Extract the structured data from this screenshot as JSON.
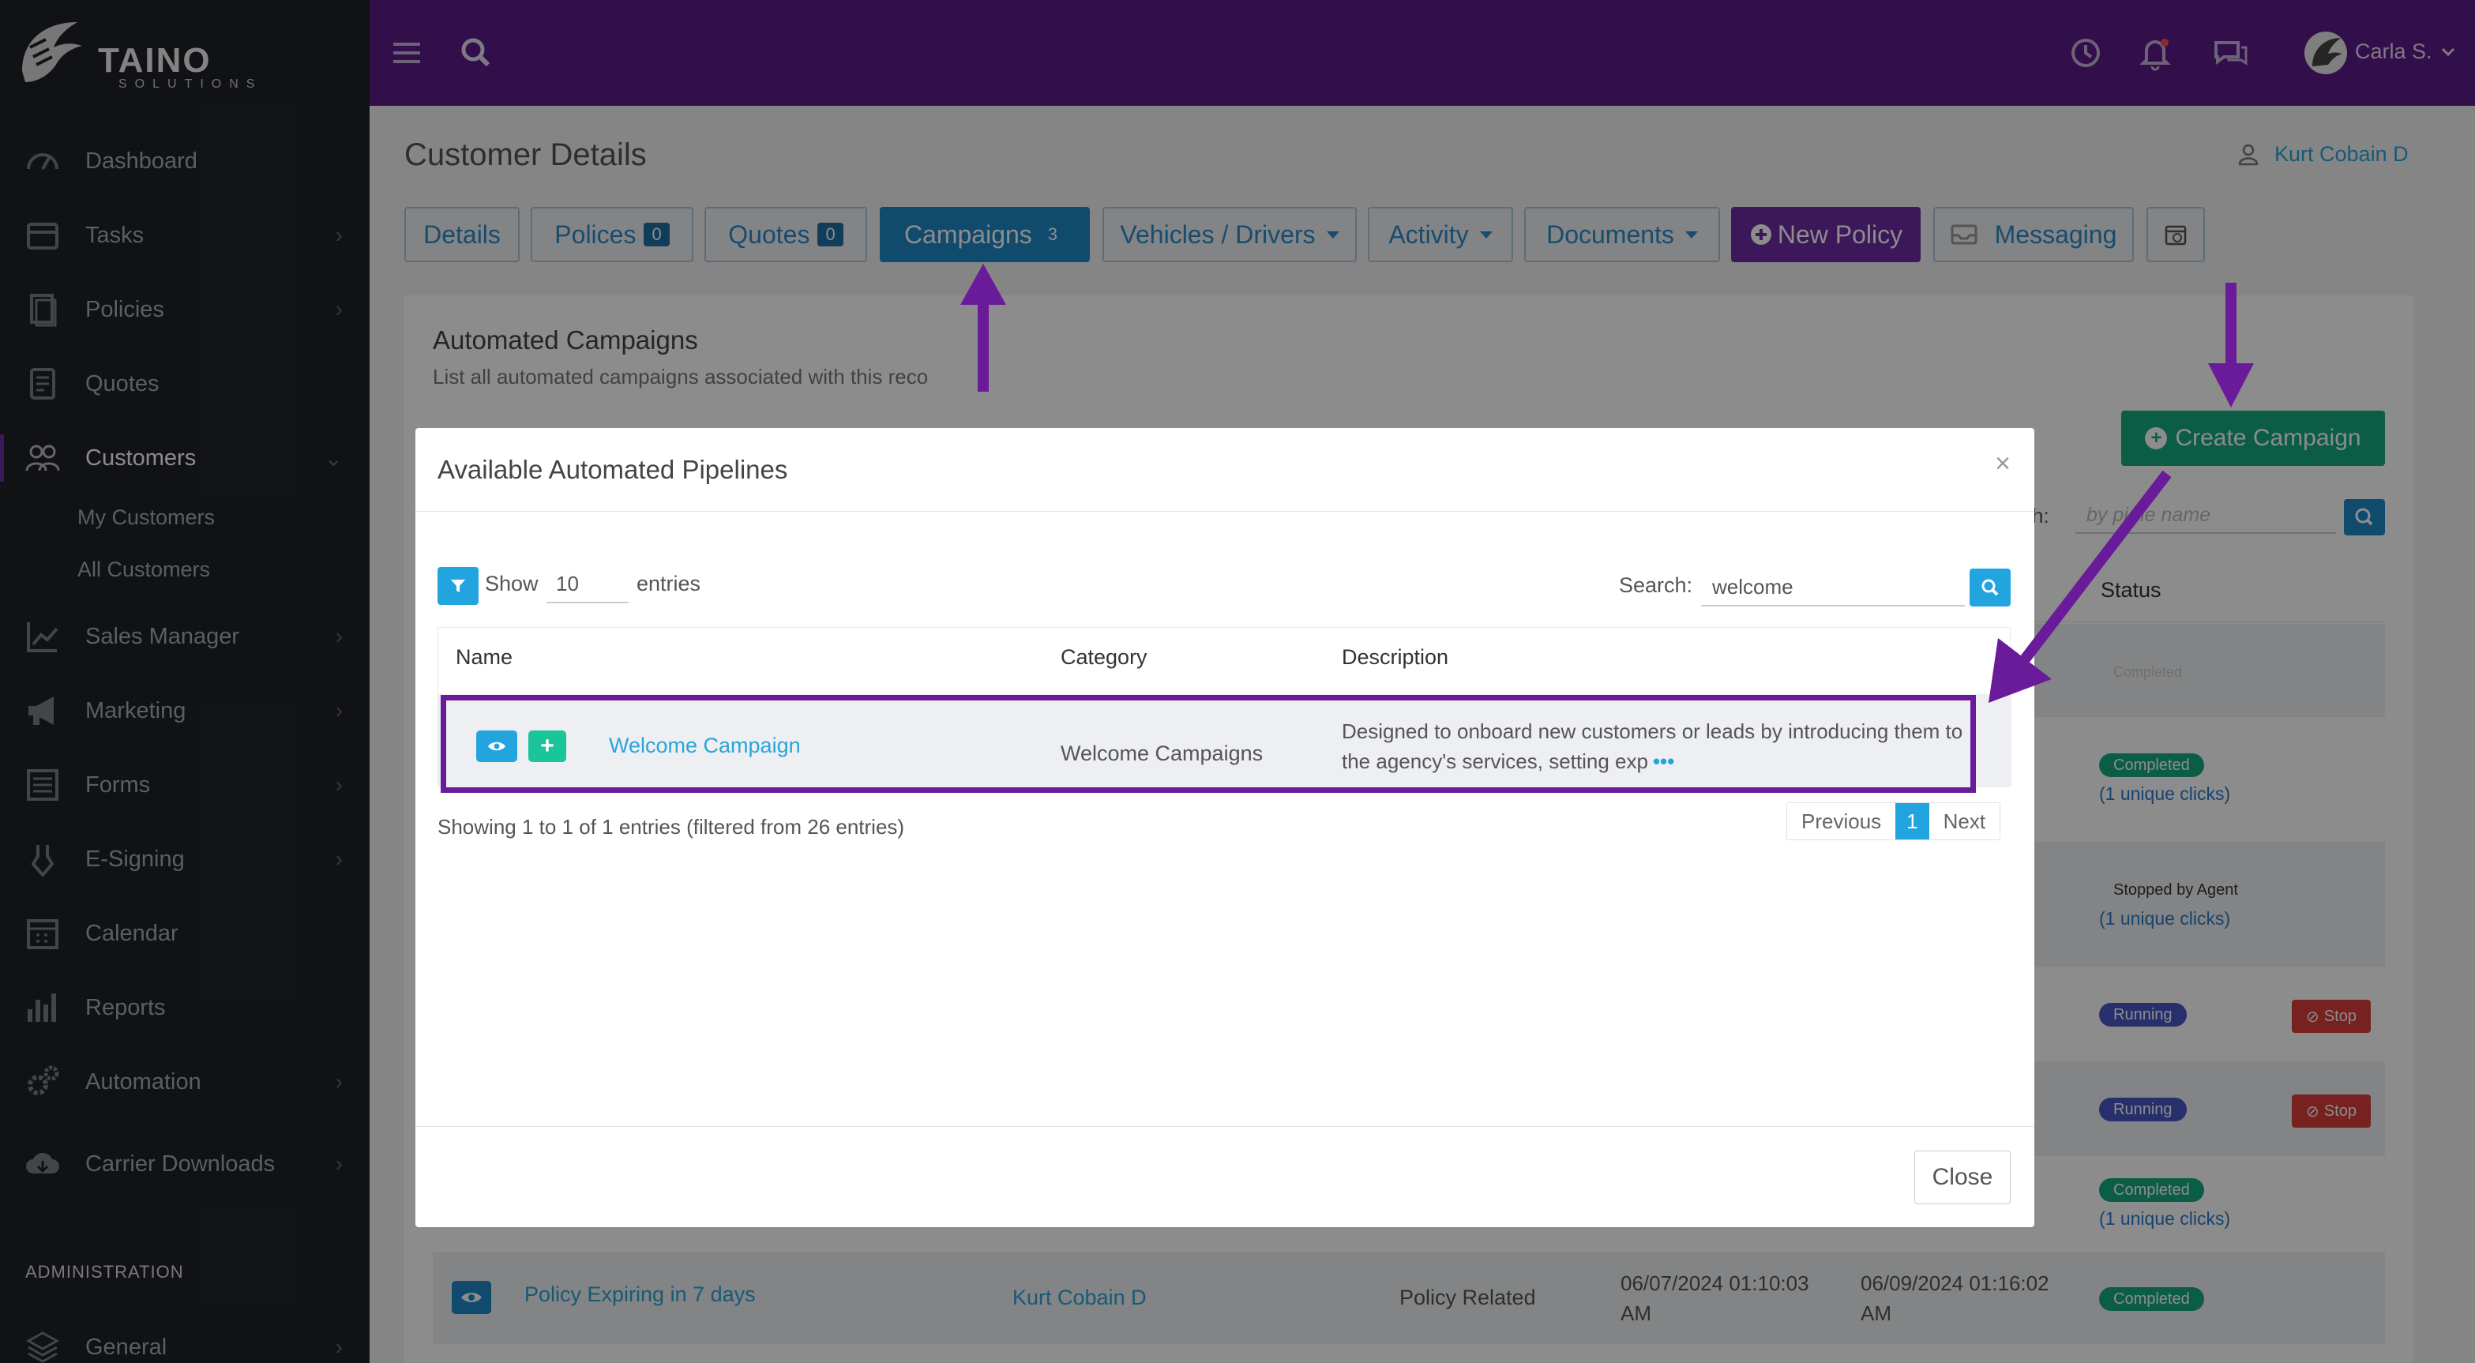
{
  "brand": {
    "name": "TAINO",
    "sub": "SOLUTIONS"
  },
  "sidebar": {
    "items": [
      {
        "label": "Dashboard",
        "icon": "dashboard-icon"
      },
      {
        "label": "Tasks",
        "icon": "tasks-icon"
      },
      {
        "label": "Policies",
        "icon": "policies-icon"
      },
      {
        "label": "Quotes",
        "icon": "quotes-icon"
      },
      {
        "label": "Customers",
        "icon": "customers-icon"
      },
      {
        "label": "Sales Manager",
        "icon": "sales-chart-icon"
      },
      {
        "label": "Marketing",
        "icon": "megaphone-icon"
      },
      {
        "label": "Forms",
        "icon": "forms-icon"
      },
      {
        "label": "E-Signing",
        "icon": "pen-icon"
      },
      {
        "label": "Calendar",
        "icon": "calendar-icon"
      },
      {
        "label": "Reports",
        "icon": "reports-icon"
      },
      {
        "label": "Automation",
        "icon": "gears-icon"
      },
      {
        "label": "Carrier Downloads",
        "icon": "cloud-download-icon"
      },
      {
        "label": "General",
        "icon": "layers-icon"
      }
    ],
    "sub_items": [
      "My Customers",
      "All Customers"
    ],
    "admin_heading": "ADMINISTRATION"
  },
  "topbar": {
    "user_name": "Carla S."
  },
  "page": {
    "title": "Customer Details",
    "customer_name": "Kurt Cobain D",
    "tabs": [
      {
        "label": "Details"
      },
      {
        "label": "Polices",
        "badge": "0"
      },
      {
        "label": "Quotes",
        "badge": "0"
      },
      {
        "label": "Campaigns",
        "badge": "3"
      },
      {
        "label": "Vehicles / Drivers"
      },
      {
        "label": "Activity"
      },
      {
        "label": "Documents"
      },
      {
        "label": "New Policy"
      },
      {
        "label": "Messaging"
      }
    ]
  },
  "campaigns_panel": {
    "title": "Automated Campaigns",
    "subtitle": "List all automated campaigns associated with this reco",
    "create_button": "Create Campaign",
    "search_label": "ch:",
    "search_placeholder": "by pi     ne name",
    "status_header": "Status",
    "rows": [
      {
        "status": "Completed",
        "clicks": ""
      },
      {
        "status": "Completed",
        "clicks": "(1 unique clicks)"
      },
      {
        "status": "Stopped by Agent",
        "clicks": "(1 unique clicks)"
      },
      {
        "status": "Running",
        "stop": "Stop"
      },
      {
        "status": "Running",
        "stop": "Stop"
      },
      {
        "status": "Completed",
        "clicks": "(1 unique clicks)"
      }
    ],
    "last_row": {
      "name": "Policy Expiring in 7 days",
      "customer": "Kurt Cobain D",
      "category": "Policy Related",
      "start_date": "06/07/2024 01:10:03",
      "start_ampm": "AM",
      "end_date": "06/09/2024 01:16:02",
      "end_ampm": "AM",
      "status": "Completed"
    }
  },
  "modal": {
    "title": "Available Automated Pipelines",
    "close_x": "×",
    "show_label": "Show",
    "show_value": "10",
    "entries_label": "entries",
    "search_label": "Search:",
    "search_value": "welcome",
    "columns": [
      "Name",
      "Category",
      "Description"
    ],
    "row": {
      "name": "Welcome Campaign",
      "category": "Welcome Campaigns",
      "description": "Designed to onboard new customers or leads by introducing them to the agency's services, setting exp",
      "more": "•••"
    },
    "info": "Showing 1 to 1 of 1 entries (filtered from 26 entries)",
    "pager": {
      "prev": "Previous",
      "current": "1",
      "next": "Next"
    },
    "close_button": "Close"
  },
  "colors": {
    "topbar": "#5b1c87",
    "sidebar": "#1f2227",
    "accent_blue": "#1e88c7",
    "annotation_purple": "#6a1b9a",
    "green": "#17a97f"
  }
}
